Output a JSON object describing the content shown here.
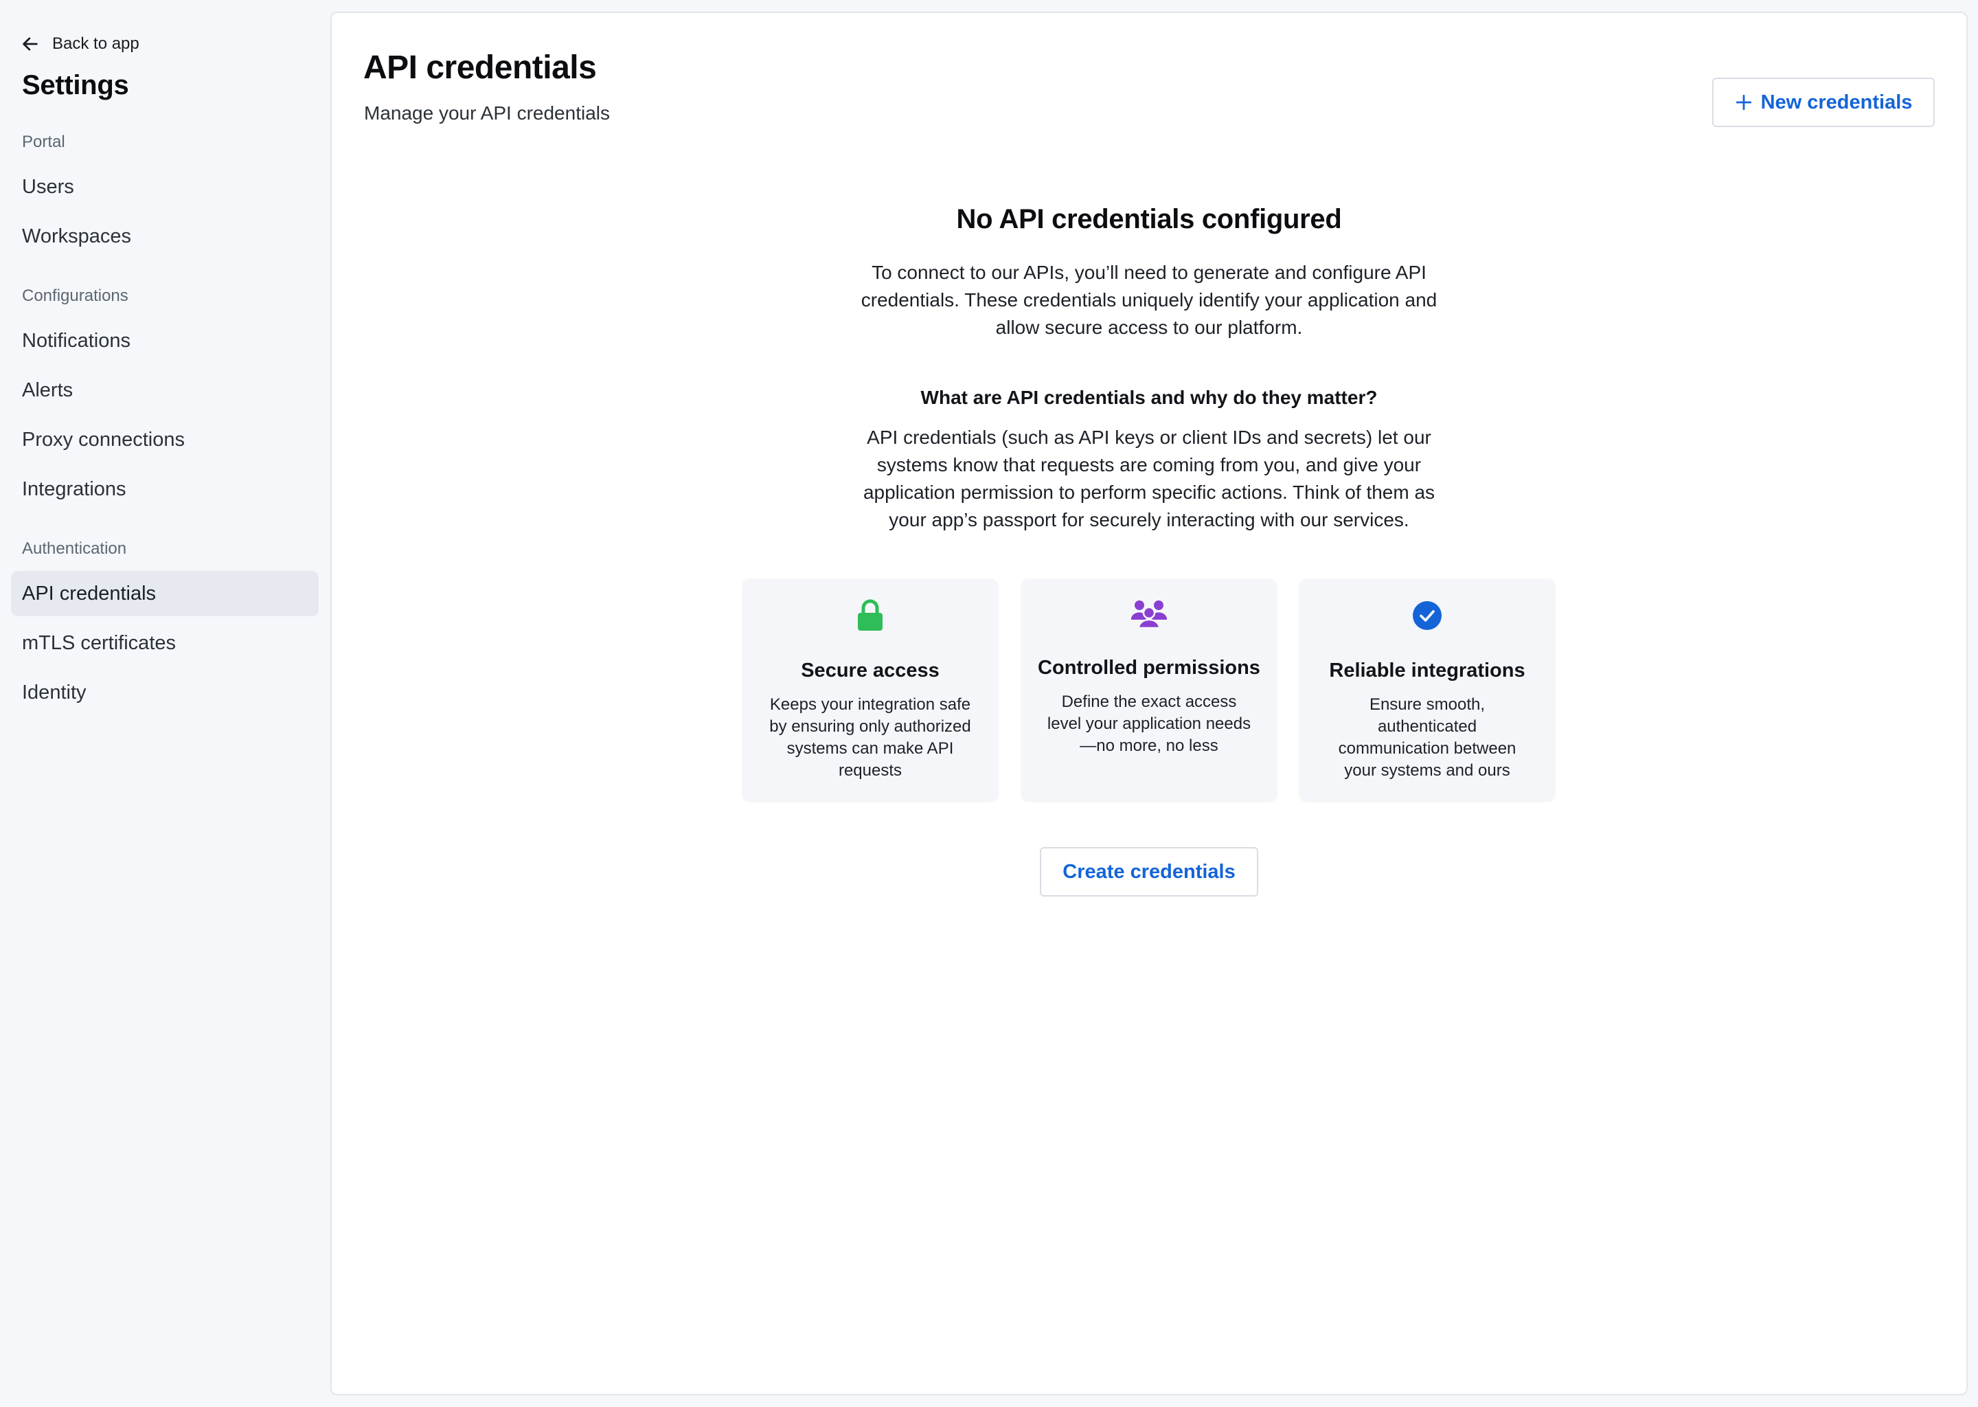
{
  "sidebar": {
    "back_label": "Back to app",
    "title": "Settings",
    "sections": [
      {
        "label": "Portal",
        "items": [
          {
            "label": "Users"
          },
          {
            "label": "Workspaces"
          }
        ]
      },
      {
        "label": "Configurations",
        "items": [
          {
            "label": "Notifications"
          },
          {
            "label": "Alerts"
          },
          {
            "label": "Proxy connections"
          },
          {
            "label": "Integrations"
          }
        ]
      },
      {
        "label": "Authentication",
        "items": [
          {
            "label": "API credentials",
            "active": true
          },
          {
            "label": "mTLS certificates"
          },
          {
            "label": "Identity"
          }
        ]
      }
    ]
  },
  "header": {
    "title": "API credentials",
    "subtitle": "Manage your API credentials",
    "new_button": "New credentials"
  },
  "empty_state": {
    "title": "No API credentials configured",
    "intro_lines": [
      "To connect to our APIs, you’ll need to generate and configure API",
      "credentials. These credentials uniquely identify your application and",
      "allow secure access to our platform."
    ],
    "question": "What are API credentials and why do they matter?",
    "answer_lines": [
      "API credentials (such as API keys or client IDs and secrets) let our",
      "systems know that requests are coming from you, and give your",
      "application permission to perform specific actions. Think of them as",
      "your app’s passport for securely interacting with our services."
    ],
    "cards": [
      {
        "icon": "lock-icon",
        "title": "Secure access",
        "desc_lines": [
          "Keeps your integration safe",
          "by ensuring only authorized",
          "systems can make API",
          "requests"
        ]
      },
      {
        "icon": "users-icon",
        "title": "Controlled permissions",
        "desc_lines": [
          "Define the exact access",
          "level your application needs",
          "—no more, no less"
        ]
      },
      {
        "icon": "check-circle-icon",
        "title": "Reliable integrations",
        "desc_lines": [
          "Ensure smooth,",
          "authenticated",
          "communication between",
          "your systems and ours"
        ]
      }
    ],
    "create_button": "Create credentials"
  },
  "colors": {
    "accent": "#1464d8",
    "lock": "#2ebd59",
    "users": "#8a3fd1",
    "check": "#1464d8",
    "sidebar_bg": "#f5f7fa",
    "active_item_bg": "#e6e9f0"
  }
}
